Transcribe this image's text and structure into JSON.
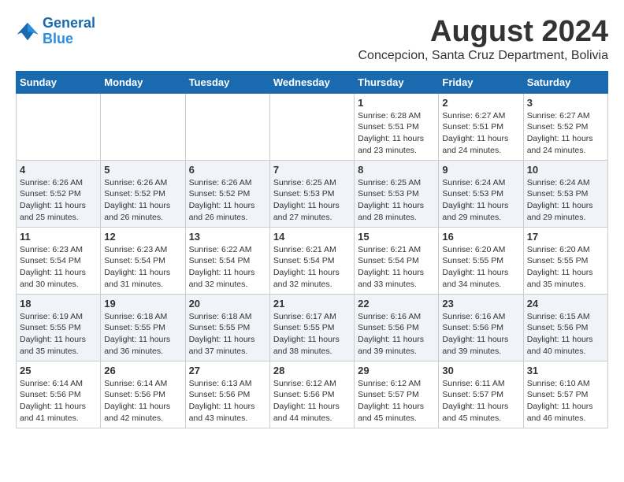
{
  "header": {
    "logo_line1": "General",
    "logo_line2": "Blue",
    "month": "August 2024",
    "location": "Concepcion, Santa Cruz Department, Bolivia"
  },
  "days_of_week": [
    "Sunday",
    "Monday",
    "Tuesday",
    "Wednesday",
    "Thursday",
    "Friday",
    "Saturday"
  ],
  "weeks": [
    [
      {
        "day": "",
        "info": ""
      },
      {
        "day": "",
        "info": ""
      },
      {
        "day": "",
        "info": ""
      },
      {
        "day": "",
        "info": ""
      },
      {
        "day": "1",
        "info": "Sunrise: 6:28 AM\nSunset: 5:51 PM\nDaylight: 11 hours\nand 23 minutes."
      },
      {
        "day": "2",
        "info": "Sunrise: 6:27 AM\nSunset: 5:51 PM\nDaylight: 11 hours\nand 24 minutes."
      },
      {
        "day": "3",
        "info": "Sunrise: 6:27 AM\nSunset: 5:52 PM\nDaylight: 11 hours\nand 24 minutes."
      }
    ],
    [
      {
        "day": "4",
        "info": "Sunrise: 6:26 AM\nSunset: 5:52 PM\nDaylight: 11 hours\nand 25 minutes."
      },
      {
        "day": "5",
        "info": "Sunrise: 6:26 AM\nSunset: 5:52 PM\nDaylight: 11 hours\nand 26 minutes."
      },
      {
        "day": "6",
        "info": "Sunrise: 6:26 AM\nSunset: 5:52 PM\nDaylight: 11 hours\nand 26 minutes."
      },
      {
        "day": "7",
        "info": "Sunrise: 6:25 AM\nSunset: 5:53 PM\nDaylight: 11 hours\nand 27 minutes."
      },
      {
        "day": "8",
        "info": "Sunrise: 6:25 AM\nSunset: 5:53 PM\nDaylight: 11 hours\nand 28 minutes."
      },
      {
        "day": "9",
        "info": "Sunrise: 6:24 AM\nSunset: 5:53 PM\nDaylight: 11 hours\nand 29 minutes."
      },
      {
        "day": "10",
        "info": "Sunrise: 6:24 AM\nSunset: 5:53 PM\nDaylight: 11 hours\nand 29 minutes."
      }
    ],
    [
      {
        "day": "11",
        "info": "Sunrise: 6:23 AM\nSunset: 5:54 PM\nDaylight: 11 hours\nand 30 minutes."
      },
      {
        "day": "12",
        "info": "Sunrise: 6:23 AM\nSunset: 5:54 PM\nDaylight: 11 hours\nand 31 minutes."
      },
      {
        "day": "13",
        "info": "Sunrise: 6:22 AM\nSunset: 5:54 PM\nDaylight: 11 hours\nand 32 minutes."
      },
      {
        "day": "14",
        "info": "Sunrise: 6:21 AM\nSunset: 5:54 PM\nDaylight: 11 hours\nand 32 minutes."
      },
      {
        "day": "15",
        "info": "Sunrise: 6:21 AM\nSunset: 5:54 PM\nDaylight: 11 hours\nand 33 minutes."
      },
      {
        "day": "16",
        "info": "Sunrise: 6:20 AM\nSunset: 5:55 PM\nDaylight: 11 hours\nand 34 minutes."
      },
      {
        "day": "17",
        "info": "Sunrise: 6:20 AM\nSunset: 5:55 PM\nDaylight: 11 hours\nand 35 minutes."
      }
    ],
    [
      {
        "day": "18",
        "info": "Sunrise: 6:19 AM\nSunset: 5:55 PM\nDaylight: 11 hours\nand 35 minutes."
      },
      {
        "day": "19",
        "info": "Sunrise: 6:18 AM\nSunset: 5:55 PM\nDaylight: 11 hours\nand 36 minutes."
      },
      {
        "day": "20",
        "info": "Sunrise: 6:18 AM\nSunset: 5:55 PM\nDaylight: 11 hours\nand 37 minutes."
      },
      {
        "day": "21",
        "info": "Sunrise: 6:17 AM\nSunset: 5:55 PM\nDaylight: 11 hours\nand 38 minutes."
      },
      {
        "day": "22",
        "info": "Sunrise: 6:16 AM\nSunset: 5:56 PM\nDaylight: 11 hours\nand 39 minutes."
      },
      {
        "day": "23",
        "info": "Sunrise: 6:16 AM\nSunset: 5:56 PM\nDaylight: 11 hours\nand 39 minutes."
      },
      {
        "day": "24",
        "info": "Sunrise: 6:15 AM\nSunset: 5:56 PM\nDaylight: 11 hours\nand 40 minutes."
      }
    ],
    [
      {
        "day": "25",
        "info": "Sunrise: 6:14 AM\nSunset: 5:56 PM\nDaylight: 11 hours\nand 41 minutes."
      },
      {
        "day": "26",
        "info": "Sunrise: 6:14 AM\nSunset: 5:56 PM\nDaylight: 11 hours\nand 42 minutes."
      },
      {
        "day": "27",
        "info": "Sunrise: 6:13 AM\nSunset: 5:56 PM\nDaylight: 11 hours\nand 43 minutes."
      },
      {
        "day": "28",
        "info": "Sunrise: 6:12 AM\nSunset: 5:56 PM\nDaylight: 11 hours\nand 44 minutes."
      },
      {
        "day": "29",
        "info": "Sunrise: 6:12 AM\nSunset: 5:57 PM\nDaylight: 11 hours\nand 45 minutes."
      },
      {
        "day": "30",
        "info": "Sunrise: 6:11 AM\nSunset: 5:57 PM\nDaylight: 11 hours\nand 45 minutes."
      },
      {
        "day": "31",
        "info": "Sunrise: 6:10 AM\nSunset: 5:57 PM\nDaylight: 11 hours\nand 46 minutes."
      }
    ]
  ]
}
